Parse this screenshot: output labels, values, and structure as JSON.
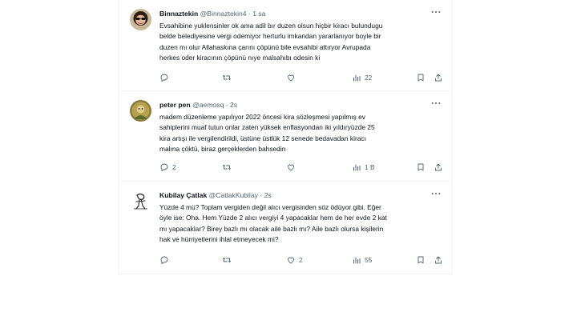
{
  "tweets": [
    {
      "name": "Binnaztekin",
      "handle": "@Binnaztekin4",
      "dot": "·",
      "time": "1 sa",
      "text": "Evsahibine yuklensinler ok ama adil bır duzen olsun hiçbir kiracı bulundugu\nbelde belediyesine vergi odemiyor herturlu imkandan yararlanıyor boyle bir\nduzen mı olur Allahaskına çarını çöpünü bile evsahibi attıryor Avrupada\nherkes oder kiracının çöpünü nıye malsahıbı odesin ki",
      "reply_count": "",
      "retweet_count": "",
      "like_count": "",
      "view_count": "22"
    },
    {
      "name": "peter pen",
      "handle": "@aemosq",
      "dot": "·",
      "time": "2s",
      "text": "madem düzenleme yapılıyor 2022 öncesi kira sözleşmesi yapılmış ev\nsahiplerini muaf tutun onlar zaten yüksek enflasyondan iki yıldıryüzde 25\nkira artışı ile vergilendirildi, üstüne üstlük 12 senede bedavadan kiracı\nmalına çöktü, biraz gerçeklerden bahsedin",
      "reply_count": "2",
      "retweet_count": "",
      "like_count": "",
      "view_count": "1 B"
    },
    {
      "name": "Kubilay Çatlak",
      "handle": "@CatlakKubilay",
      "dot": "·",
      "time": "2s",
      "text": "Yüzde 4 mü? Toplam vergiden değil alıcı vergisinden söz ödüyor gibi. Eğer\nöyle ise: Oha. Hem Yüzde 2 alıcı vergiyi 4 yapacaklar hem de her evde 2 kat\nmı yapacaklar? Birey bazlı mı olacak aile bazlı mı? Aile bazlı olursa kişilerin\nhak ve hürriyetlerini ihlal etmeyecek mi?",
      "reply_count": "",
      "retweet_count": "",
      "like_count": "2",
      "view_count": "55"
    }
  ],
  "icons": {
    "more": "more-horizontal-icon",
    "reply": "reply-icon",
    "retweet": "retweet-icon",
    "like": "heart-icon",
    "views": "views-chart-icon",
    "bookmark": "bookmark-icon",
    "share": "share-icon"
  },
  "colors": {
    "text": "#0f1419",
    "secondary": "#536471",
    "divider": "#eff3f4"
  }
}
